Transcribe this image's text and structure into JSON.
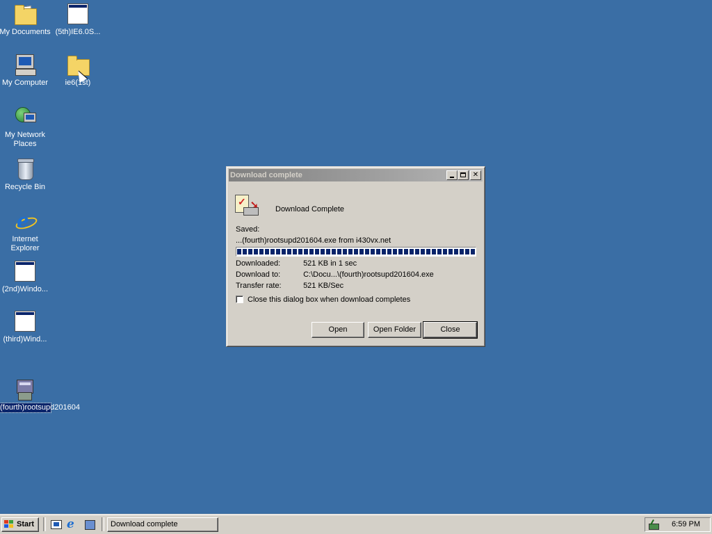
{
  "desktop": {
    "background": "#3a6ea5",
    "icons": [
      {
        "label": "My Documents",
        "icon": "my-documents-icon"
      },
      {
        "label": "(5th)IE6.0S...",
        "icon": "window-icon"
      },
      {
        "label": "My Computer",
        "icon": "my-computer-icon"
      },
      {
        "label": "ie6(1st)",
        "icon": "folder-icon"
      },
      {
        "label": "My Network Places",
        "icon": "network-places-icon"
      },
      {
        "label": "Recycle Bin",
        "icon": "recycle-bin-icon"
      },
      {
        "label": "Internet Explorer",
        "icon": "internet-explorer-icon"
      },
      {
        "label": "(2nd)Windo...",
        "icon": "window-icon"
      },
      {
        "label": "(third)Wind...",
        "icon": "window-icon"
      },
      {
        "label": "(fourth)rootsupd201604",
        "icon": "installer-icon",
        "selected": true
      }
    ]
  },
  "dialog": {
    "title": "Download complete",
    "heading": "Download Complete",
    "saved_label": "Saved:",
    "file_line": "...(fourth)rootsupd201604.exe from i430vx.net",
    "progress": 1.0,
    "rows": [
      {
        "key": "Downloaded:",
        "value": "521 KB in 1 sec"
      },
      {
        "key": "Download to:",
        "value": "C:\\Docu...\\(fourth)rootsupd201604.exe"
      },
      {
        "key": "Transfer rate:",
        "value": "521 KB/Sec"
      }
    ],
    "checkbox_label": "Close this dialog box when download completes",
    "checkbox_checked": false,
    "buttons": {
      "open": "Open",
      "open_folder": "Open Folder",
      "close": "Close"
    }
  },
  "taskbar": {
    "start_label": "Start",
    "task_button": "Download complete",
    "clock": "6:59 PM"
  }
}
